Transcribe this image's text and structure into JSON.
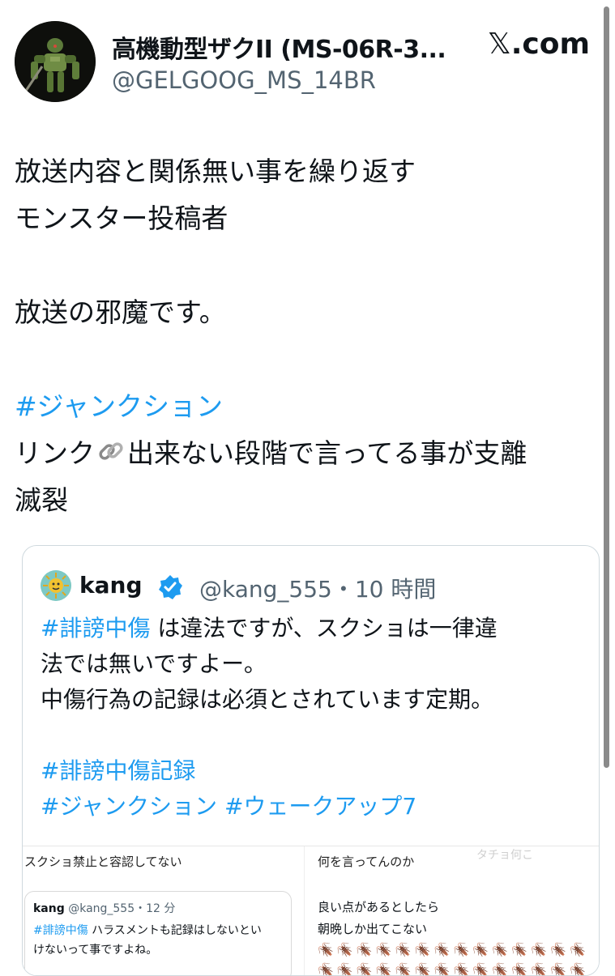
{
  "author": {
    "name": "高機動型ザクII (MS-06R-3...",
    "handle": "@GELGOOG_MS_14BR",
    "avatar_icon": "robot-figure-avatar"
  },
  "brand": {
    "x_glyph": "𝕏",
    "domain": ".com"
  },
  "post": {
    "lines": [
      "放送内容と関係無い事を繰り返す",
      "モンスター投稿者",
      "",
      "放送の邪魔です。",
      "",
      "#ジャンクション",
      "リンク",
      "出来ない段階で言ってる事が支離",
      "滅裂"
    ],
    "link_icon": "link-icon",
    "hashtag_color": "#1d9bf0"
  },
  "quote": {
    "name": "kang",
    "handle_time": "@kang_555・10 時間",
    "hashtag1": "#誹謗中傷",
    "line1_rest": " は違法ですが、スクショは一律違",
    "line2": "法では無いですよー。",
    "line3": "中傷行為の記録は必須とされています定期。",
    "hashtag2": "#誹謗中傷記録",
    "hashtag3": "#ジャンクション",
    "hashtag4": "#ウェークアップ7"
  },
  "quote_media": {
    "left_label": "スクショ禁止と容認してない",
    "right_label": "何を言ってんのか",
    "faint_label": "タチョ何こ",
    "card": {
      "name": "kang",
      "handle": "@kang_555・12 分",
      "hashtag": "#誹謗中傷",
      "line1_rest": " ハラスメントも記録はしないとい",
      "line2": "けないって事ですよね。"
    },
    "right_line1": "良い点があるとしたら",
    "right_line2": "朝晩しか出てこない",
    "bugs": "🪳🪳🪳🪳🪳🪳🪳🪳🪳🪳🪳🪳🪳🪳"
  }
}
